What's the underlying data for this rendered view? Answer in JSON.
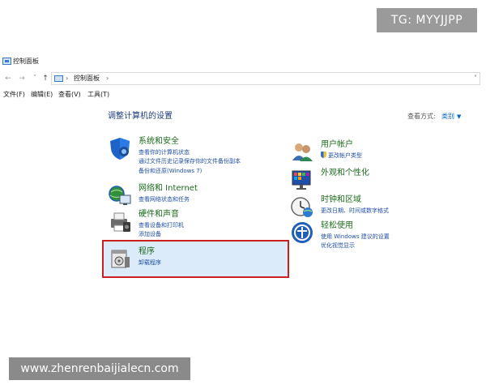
{
  "watermarks": {
    "top": "TG: MYYJJPP",
    "bottom": "www.zhenrenbaijialecn.com"
  },
  "window": {
    "title": "控制面板"
  },
  "nav": {
    "back": "←",
    "forward": "→",
    "recent": "˅",
    "up": "↑",
    "sep1": "›",
    "crumb": "控制面板",
    "sep2": "›",
    "dropdown": "˅"
  },
  "menu": [
    "文件(F)",
    "编辑(E)",
    "查看(V)",
    "工具(T)"
  ],
  "heading": "调整计算机的设置",
  "view_by": {
    "label": "查看方式:",
    "value": "类别",
    "caret": "▼"
  },
  "categories_left": [
    {
      "title": "系统和安全",
      "links": [
        "查看你的计算机状态",
        "通过文件历史记录保存你的文件备份副本",
        "备份和还原(Windows 7)"
      ],
      "icon": "shield-icon"
    },
    {
      "title": "网络和 Internet",
      "links": [
        "查看网络状态和任务"
      ],
      "icon": "network-icon"
    },
    {
      "title": "硬件和声音",
      "links": [
        "查看设备和打印机",
        "添加设备"
      ],
      "icon": "printer-icon"
    },
    {
      "title": "程序",
      "links": [
        "卸载程序"
      ],
      "icon": "programs-icon"
    }
  ],
  "categories_right": [
    {
      "title": "用户帐户",
      "links": [
        "更改帐户类型"
      ],
      "icon": "users-icon"
    },
    {
      "title": "外观和个性化",
      "links": [],
      "icon": "appearance-icon"
    },
    {
      "title": "时钟和区域",
      "links": [
        "更改日期、时间或数字格式"
      ],
      "icon": "clock-icon"
    },
    {
      "title": "轻松使用",
      "links": [
        "使用 Windows 建议的设置",
        "优化视觉显示"
      ],
      "icon": "ease-of-access-icon"
    }
  ],
  "colors": {
    "highlight_border": "#cc2020",
    "highlight_fill": "#dcebf9",
    "category_title": "#1d6b1d",
    "link": "#1f4fa6"
  }
}
